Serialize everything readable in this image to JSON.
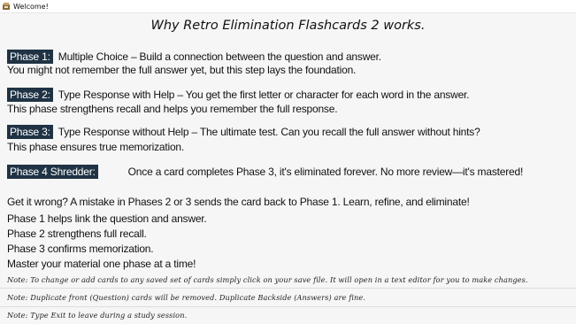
{
  "window": {
    "title": "Welcome!",
    "app_icon": "app-icon"
  },
  "heading": "Why Retro Elimination Flashcards 2 works.",
  "phases": [
    {
      "badge": "Phase 1:",
      "text": "Multiple Choice – Build a connection between the question and answer.",
      "subtext": "You might not remember the full answer yet, but this step lays the foundation."
    },
    {
      "badge": "Phase 2:",
      "text": "Type Response with Help – You get the first letter or character for each word in the answer.",
      "subtext": "This phase strengthens recall and helps you remember the full response."
    },
    {
      "badge": "Phase 3:",
      "text": "Type Response without Help – The ultimate test. Can you recall the full answer without hints?",
      "subtext": "This phase ensures true memorization."
    },
    {
      "badge": "Phase 4 Shredder:",
      "text": "Once a card completes Phase 3, it's eliminated forever. No more review—it's mastered!"
    }
  ],
  "wrong_text": "Get it wrong? A mistake in Phases 2 or 3 sends the card back to Phase 1. Learn, refine, and eliminate!",
  "summary": [
    "Phase 1 helps link the question and answer.",
    "Phase 2 strengthens full recall.",
    "Phase 3 confirms memorization.",
    "Master your material one phase at a time!"
  ],
  "notes": [
    "Note: To change or add cards to any saved set of cards simply click on your save file. It will open in a text editor for you to make changes.",
    "Note: Duplicate front (Question) cards will be removed. Duplicate Backside (Answers) are fine.",
    "Note: Type Exit to leave during a study session."
  ]
}
